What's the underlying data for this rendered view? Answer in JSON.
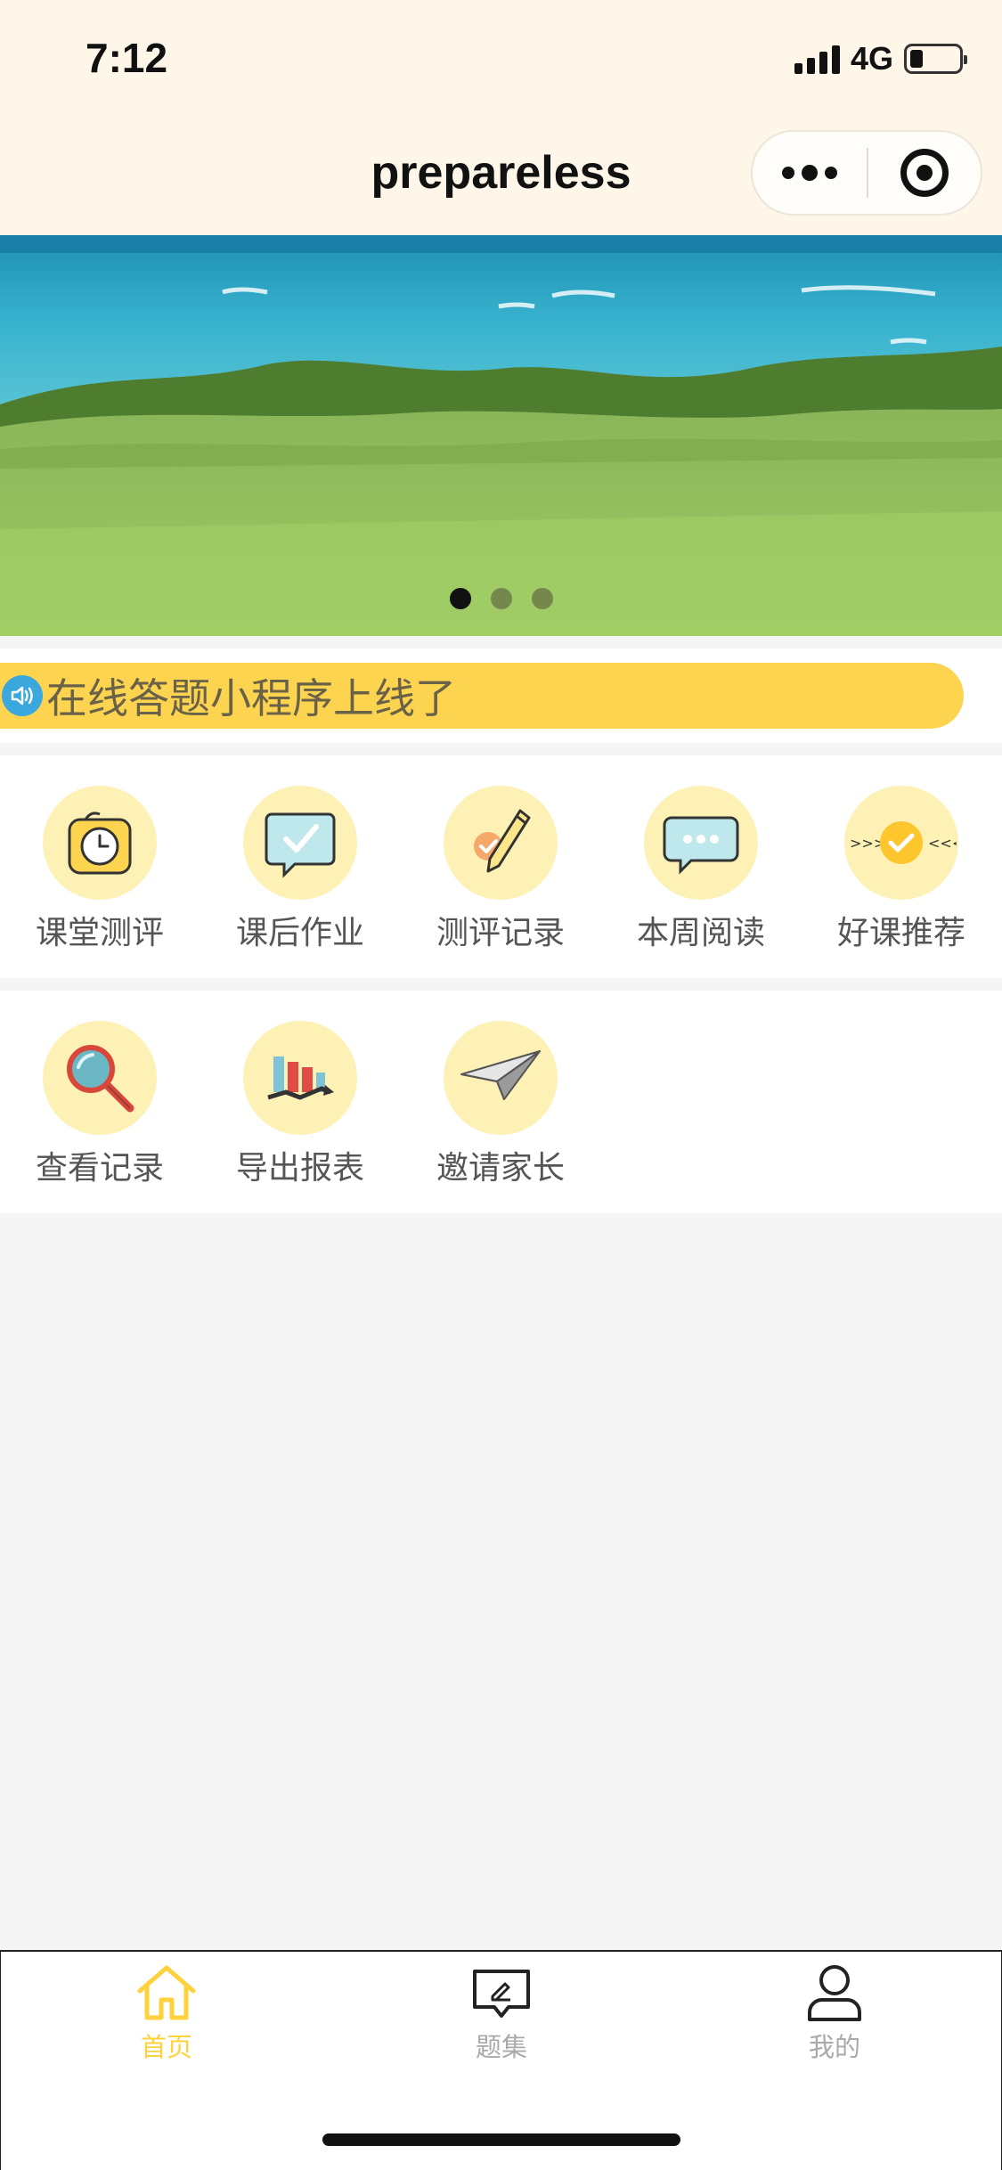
{
  "status_bar": {
    "time": "7:12",
    "network": "4G",
    "battery_level": 0.25
  },
  "nav_bar": {
    "title": "prepareless",
    "more_icon": "more-dots-icon",
    "close_icon": "target-icon"
  },
  "banner": {
    "image": "seaside-grass-landscape",
    "slide_count": 3,
    "active_slide": 1
  },
  "notice": {
    "icon": "speaker-icon",
    "text": "在线答题小程序上线了"
  },
  "grid": {
    "row1": [
      {
        "label": "课堂测评",
        "icon": "alarm-clock-icon"
      },
      {
        "label": "课后作业",
        "icon": "check-bubble-icon"
      },
      {
        "label": "测评记录",
        "icon": "pencil-check-icon"
      },
      {
        "label": "本周阅读",
        "icon": "chat-bubble-icon"
      },
      {
        "label": "好课推荐",
        "icon": "check-badge-icon"
      }
    ],
    "row2": [
      {
        "label": "查看记录",
        "icon": "magnifier-icon"
      },
      {
        "label": "导出报表",
        "icon": "bar-chart-icon"
      },
      {
        "label": "邀请家长",
        "icon": "paper-plane-icon"
      }
    ]
  },
  "tab_bar": {
    "tabs": [
      {
        "label": "首页",
        "icon": "home-icon",
        "active": true
      },
      {
        "label": "题集",
        "icon": "question-set-icon",
        "active": false
      },
      {
        "label": "我的",
        "icon": "user-icon",
        "active": false
      }
    ]
  },
  "colors": {
    "header_bg": "#fdf6e9",
    "accent": "#fdd450",
    "icon_circle": "#fdf1b6",
    "tab_active": "#fdd23c",
    "tab_inactive": "#a9a9a9"
  }
}
